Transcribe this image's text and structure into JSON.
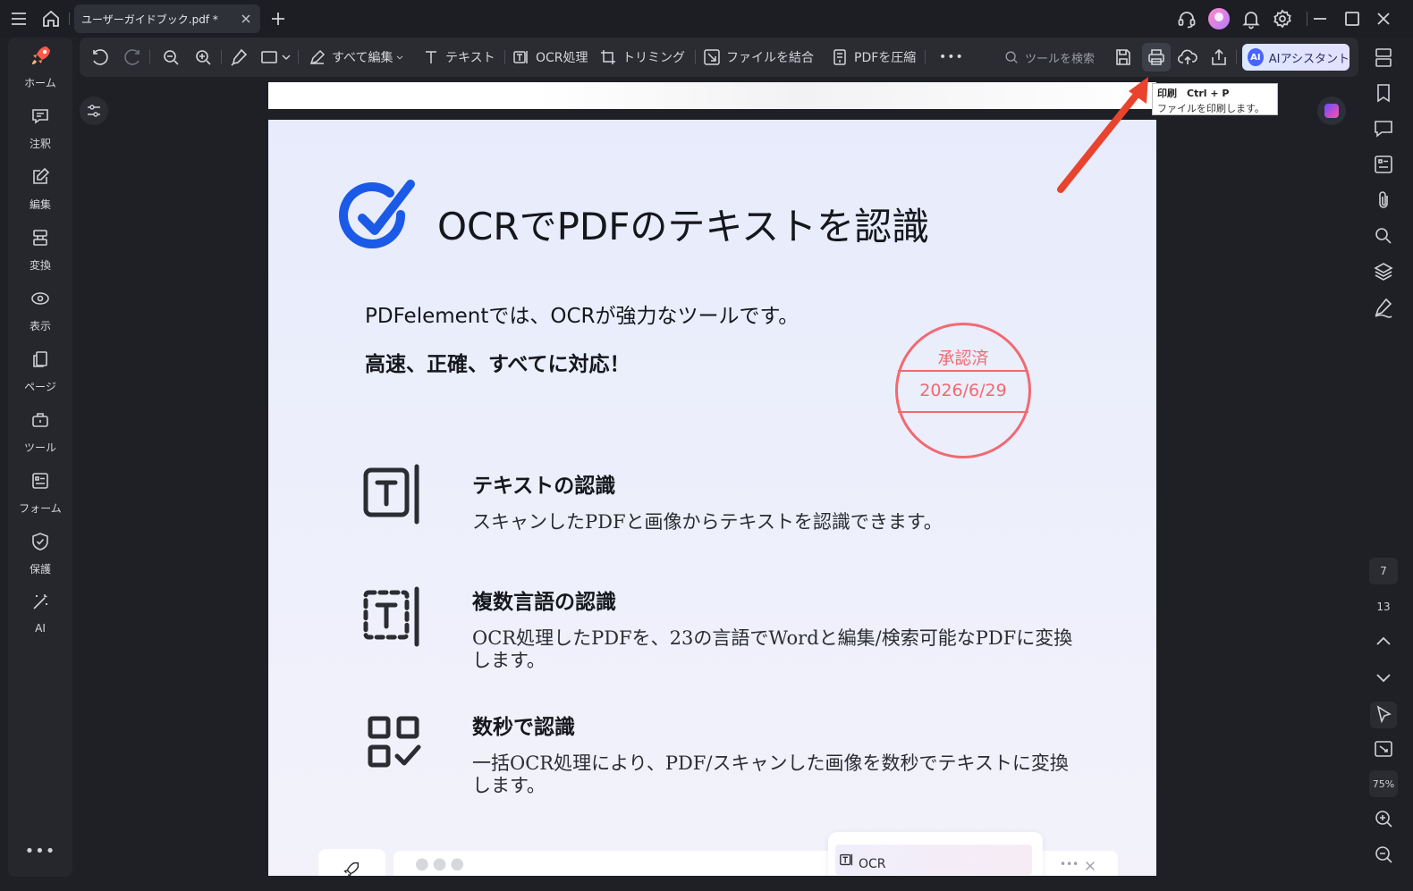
{
  "titlebar": {
    "tab_title": "ユーザーガイドブック.pdf *"
  },
  "sidebar": {
    "items": [
      {
        "label": "ホーム",
        "icon": "rocket-icon"
      },
      {
        "label": "注釈",
        "icon": "comment-icon"
      },
      {
        "label": "編集",
        "icon": "edit-icon"
      },
      {
        "label": "変換",
        "icon": "convert-icon"
      },
      {
        "label": "表示",
        "icon": "view-icon"
      },
      {
        "label": "ページ",
        "icon": "page-icon"
      },
      {
        "label": "ツール",
        "icon": "toolbox-icon"
      },
      {
        "label": "フォーム",
        "icon": "form-icon"
      },
      {
        "label": "保護",
        "icon": "shield-icon"
      },
      {
        "label": "AI",
        "icon": "magic-wand-icon"
      }
    ],
    "more": "•••"
  },
  "toolbar": {
    "edit_all": "すべて編集",
    "text": "テキスト",
    "ocr": "OCR処理",
    "crop": "トリミング",
    "merge": "ファイルを結合",
    "compress": "PDFを圧縮",
    "more": "•••",
    "search_placeholder": "ツールを検索",
    "ai_badge": "AI",
    "ai_assistant": "AIアシスタント"
  },
  "tooltip": {
    "title": "印刷　Ctrl + P",
    "desc": "ファイルを印刷します。"
  },
  "document": {
    "heading": "OCRでPDFのテキストを認識",
    "intro1": "PDFelementでは、OCRが強力なツールです。",
    "intro2": "高速、正確、すべてに対応！",
    "stamp": {
      "title": "承認済",
      "date": "2026/6/29"
    },
    "features": [
      {
        "title": "テキストの認識",
        "desc": "スキャンしたPDFと画像からテキストを認識できます。"
      },
      {
        "title": "複数言語の認識",
        "desc": "OCR処理したPDFを、23の言語でWordと編集/検索可能なPDFに変換します。"
      },
      {
        "title": "数秒で認識",
        "desc": "一括OCR処理により、PDF/スキャンした画像を数秒でテキストに変換します。"
      }
    ],
    "ocr_chip": "OCR"
  },
  "right_panel": {
    "page_current": "7",
    "page_total": "13",
    "zoom": "75%"
  },
  "colors": {
    "stamp": "#f06a72",
    "accent_arrow": "#e8432d",
    "check_blue": "#1a5ae6"
  }
}
